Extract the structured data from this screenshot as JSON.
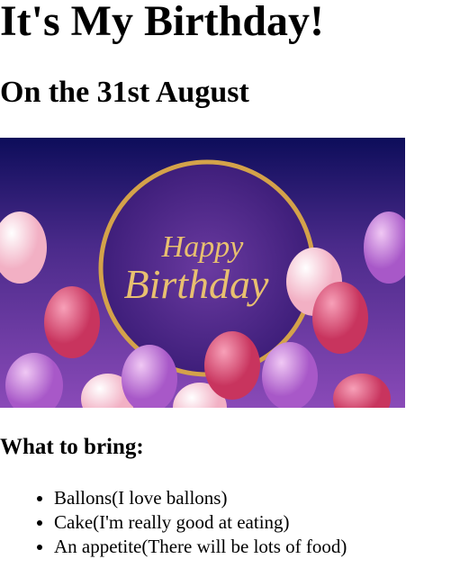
{
  "title": "It's My Birthday!",
  "subtitle": "On the 31st August",
  "banner": {
    "text_line1": "Happy",
    "text_line2": "Birthday",
    "colors": {
      "background": "#4a2a8a",
      "ring": "#d4a24a",
      "balloon_pink": "#e0507a",
      "balloon_light": "#fbd8e0",
      "balloon_purple": "#c07ad8"
    }
  },
  "bring_heading": "What to bring:",
  "items": [
    "Ballons(I love ballons)",
    "Cake(I'm really good at eating)",
    "An appetite(There will be lots of food)"
  ]
}
